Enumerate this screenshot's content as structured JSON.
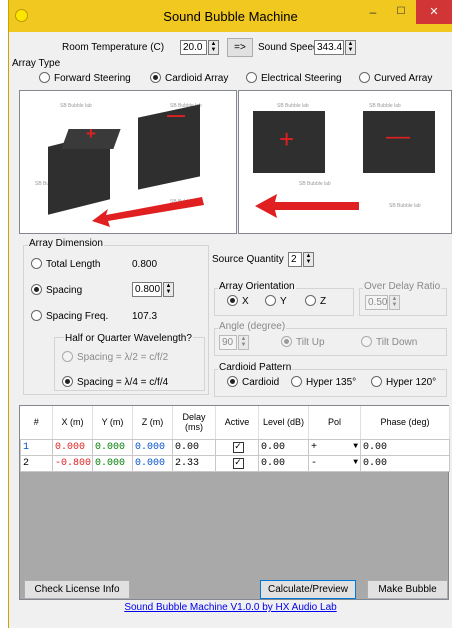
{
  "window": {
    "title": "Sound Bubble Machine",
    "min_glyph": "–",
    "max_glyph": "☐",
    "close_glyph": "✕",
    "accent": "#f0c81f"
  },
  "top": {
    "room_temp_label": "Room Temperature (C)",
    "room_temp_value": "20.0",
    "arrow_button": "=>",
    "speed_label": "Sound Speed",
    "speed_value": "343.4"
  },
  "array_type": {
    "label": "Array Type",
    "options": [
      {
        "label": "Forward Steering",
        "selected": false
      },
      {
        "label": "Cardioid Array",
        "selected": true
      },
      {
        "label": "Electrical Steering",
        "selected": false
      },
      {
        "label": "Curved Array",
        "selected": false
      }
    ]
  },
  "watermark": "SB Bubble lab",
  "dimension": {
    "label": "Array Dimension",
    "total_length_label": "Total Length",
    "total_length_value": "0.800",
    "spacing_label": "Spacing",
    "spacing_value": "0.800",
    "spacing_freq_label": "Spacing Freq.",
    "spacing_freq_value": "107.3",
    "wave_label": "Half or Quarter Wavelength?",
    "half_label": "Spacing = λ/2 = c/f/2",
    "quarter_label": "Spacing = λ/4 = c/f/4"
  },
  "source": {
    "label": "Source Quantity",
    "value": "2"
  },
  "orientation": {
    "label": "Array Orientation",
    "x": "X",
    "y": "Y",
    "z": "Z"
  },
  "over_delay": {
    "label": "Over Delay Ratio",
    "value": "0.50"
  },
  "angle": {
    "label": "Angle (degree)",
    "value": "90",
    "tilt_up": "Tilt Up",
    "tilt_down": "Tilt Down"
  },
  "cardioid": {
    "label": "Cardioid Pattern",
    "options": [
      "Cardioid",
      "Hyper 135°",
      "Hyper 120°"
    ]
  },
  "table": {
    "headers": [
      "#",
      "X (m)",
      "Y (m)",
      "Z (m)",
      "Delay (ms)",
      "Active",
      "Level (dB)",
      "Pol",
      "Phase (deg)"
    ],
    "rows": [
      {
        "n": "1",
        "x": "0.000",
        "y": "0.000",
        "z": "0.000",
        "delay": "0.00",
        "active": true,
        "level": "0.00",
        "pol": "+",
        "phase": "0.00"
      },
      {
        "n": "2",
        "x": "-0.800",
        "y": "0.000",
        "z": "0.000",
        "delay": "2.33",
        "active": true,
        "level": "0.00",
        "pol": "-",
        "phase": "0.00"
      }
    ]
  },
  "buttons": {
    "license": "Check License Info",
    "calculate": "Calculate/Preview",
    "make": "Make Bubble"
  },
  "footer": {
    "link": "Sound Bubble Machine V1.0.0 by HX Audio Lab"
  },
  "colors": {
    "x": "#e02020",
    "y": "#008000",
    "z": "#0050d0",
    "plus": "#e02020",
    "minus": "#e02020"
  }
}
